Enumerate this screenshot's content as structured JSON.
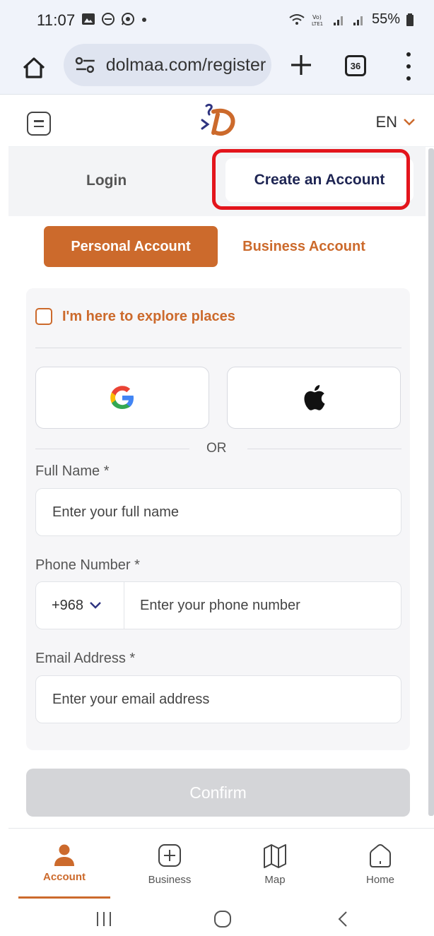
{
  "status_bar": {
    "time": "11:07",
    "battery": "55%"
  },
  "browser": {
    "url": "dolmaa.com/register",
    "tab_count": "36"
  },
  "site_header": {
    "language": "EN"
  },
  "auth_tabs": {
    "login": "Login",
    "create_account": "Create an Account"
  },
  "account_type": {
    "personal": "Personal Account",
    "business": "Business Account"
  },
  "form": {
    "explore_label": "I'm here to explore places",
    "or_text": "OR",
    "full_name_label": "Full Name *",
    "full_name_placeholder": "Enter your full name",
    "phone_label": "Phone Number *",
    "phone_code": "+968",
    "phone_placeholder": "Enter your phone number",
    "email_label": "Email Address *",
    "email_placeholder": "Enter your email address",
    "confirm": "Confirm"
  },
  "bottom_nav": [
    {
      "label": "Account",
      "icon": "person-icon",
      "active": true
    },
    {
      "label": "Business",
      "icon": "plus-square-icon",
      "active": false
    },
    {
      "label": "Map",
      "icon": "map-icon",
      "active": false
    },
    {
      "label": "Home",
      "icon": "home-icon",
      "active": false
    }
  ],
  "colors": {
    "brand": "#cc6a2c",
    "navy": "#1e2553",
    "highlight": "#e3151c",
    "disabled_button": "#d4d5d8"
  }
}
